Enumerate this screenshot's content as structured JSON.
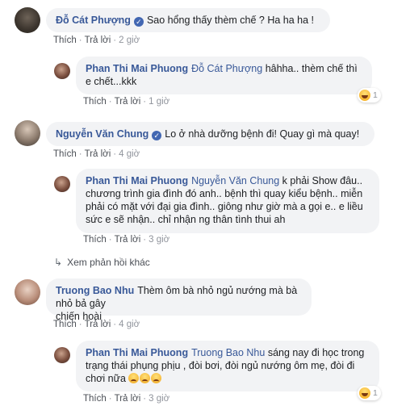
{
  "comments": [
    {
      "name": "Đỗ Cát Phượng",
      "text": "Sao hổng thấy thèm chế ? Ha ha ha !",
      "like": "Thích",
      "reply": "Trả lời",
      "time": "2 giờ",
      "reply_item": {
        "name": "Phan Thi Mai Phuong",
        "mention": "Đỗ Cát Phượng",
        "text_line1": "hâhha.. thèm chế thì",
        "text_line2": "e chết...kkk",
        "like": "Thích",
        "reply": "Trả lời",
        "time": "1 giờ",
        "reaction_count": "1"
      }
    },
    {
      "name": "Nguyễn Văn Chung",
      "text": "Lo ở nhà dưỡng bệnh đi! Quay gì mà quay!",
      "like": "Thích",
      "reply": "Trả lời",
      "time": "4 giờ",
      "reply_item": {
        "name": "Phan Thi Mai Phuong",
        "mention": "Nguyễn Văn Chung",
        "text_line1_rest": "k phải Show đâu..",
        "text_line2": "chương trình gia đình đó anh.. bệnh thì quay kiểu bệnh.. miễn",
        "text_line3": "phải có mặt với đại gia đình.. giông như giờ mà a gọi e.. e liều",
        "text_line4": "sức e sẽ nhận.. chỉ nhận ng thân tình thui ah",
        "like": "Thích",
        "reply": "Trả lời",
        "time": "3 giờ"
      },
      "more_replies": "Xem phản hồi khác"
    },
    {
      "name": "Truong Bao Nhu",
      "text_line1": "Thèm ôm bà nhỏ ngủ nướng mà bà nhỏ bả gây",
      "text_line2": "chiến hoài",
      "like": "Thích",
      "reply": "Trả lời",
      "time": "4 giờ",
      "reply_item": {
        "name": "Phan Thi Mai Phuong",
        "mention": "Truong Bao Nhu",
        "text_line1_rest": "sáng nay đi học trong",
        "text_line2": "trạng thái phụng phịu , đòi bơi, đòi ngủ nướng ôm mẹ, đòi đi",
        "text_line3": "chơi nữa",
        "like": "Thích",
        "reply": "Trả lời",
        "time": "3 giờ",
        "reaction_count": "1"
      }
    }
  ],
  "icons": {
    "verified": "verified-badge-icon",
    "reply_arrow": "reply-arrow-icon",
    "reaction": "haha-reaction-icon"
  },
  "colors": {
    "name": "#385898",
    "bubble": "#f2f3f5",
    "meta": "#90949c",
    "verified": "#4267b2"
  }
}
